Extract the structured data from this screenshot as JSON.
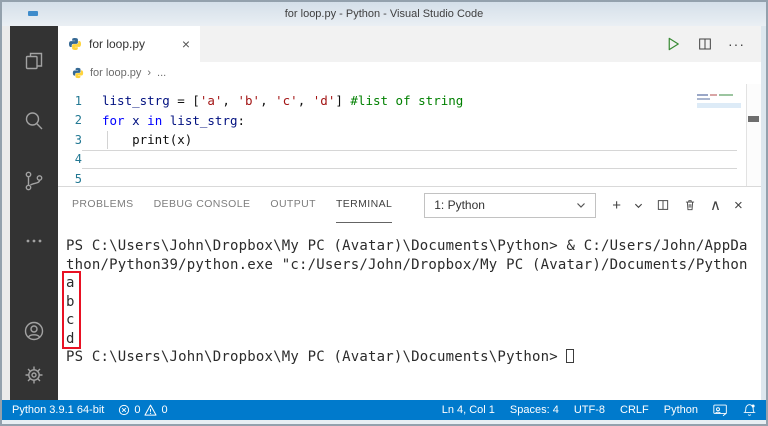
{
  "window": {
    "title": "for loop.py - Python - Visual Studio Code"
  },
  "activity_bar": {
    "items": [
      {
        "name": "explorer",
        "icon": "files-icon"
      },
      {
        "name": "search",
        "icon": "search-icon"
      },
      {
        "name": "source-control",
        "icon": "source-control-icon"
      },
      {
        "name": "more-views",
        "icon": "more-icon"
      }
    ],
    "bottom_items": [
      {
        "name": "account",
        "icon": "account-icon"
      },
      {
        "name": "settings",
        "icon": "gear-icon"
      }
    ]
  },
  "editor": {
    "tab": {
      "label": "for loop.py",
      "close": "×"
    },
    "actions": {
      "run_tooltip": "Run Python File",
      "more": "···"
    },
    "breadcrumb": {
      "file": "for loop.py",
      "sep": "›",
      "more": "..."
    },
    "code_lines": [
      {
        "num": "1",
        "tokens": [
          {
            "t": "list_strg",
            "c": "tok-var"
          },
          {
            "t": " = [",
            "c": "tok-p"
          },
          {
            "t": "'a'",
            "c": "tok-str"
          },
          {
            "t": ", ",
            "c": "tok-p"
          },
          {
            "t": "'b'",
            "c": "tok-str"
          },
          {
            "t": ", ",
            "c": "tok-p"
          },
          {
            "t": "'c'",
            "c": "tok-str"
          },
          {
            "t": ", ",
            "c": "tok-p"
          },
          {
            "t": "'d'",
            "c": "tok-str"
          },
          {
            "t": "] ",
            "c": "tok-p"
          },
          {
            "t": "#list of string",
            "c": "tok-com"
          }
        ]
      },
      {
        "num": "2",
        "tokens": [
          {
            "t": "for",
            "c": "tok-kw"
          },
          {
            "t": " ",
            "c": "tok-p"
          },
          {
            "t": "x",
            "c": "tok-var"
          },
          {
            "t": " ",
            "c": "tok-p"
          },
          {
            "t": "in",
            "c": "tok-kw"
          },
          {
            "t": " ",
            "c": "tok-p"
          },
          {
            "t": "list_strg",
            "c": "tok-var"
          },
          {
            "t": ":",
            "c": "tok-p"
          }
        ]
      },
      {
        "num": "3",
        "indent_guide": true,
        "tokens": [
          {
            "t": "    print(x)",
            "c": "tok-p"
          }
        ]
      },
      {
        "num": "4",
        "current": true,
        "tokens": []
      },
      {
        "num": "5",
        "tokens": []
      }
    ]
  },
  "panel": {
    "tabs": [
      {
        "label": "PROBLEMS"
      },
      {
        "label": "DEBUG CONSOLE"
      },
      {
        "label": "OUTPUT"
      },
      {
        "label": "TERMINAL",
        "active": true
      }
    ],
    "terminal_select": {
      "value": "1: Python"
    },
    "icons": {
      "new": "+",
      "split": "split-icon",
      "kill": "trash-icon",
      "maximize": "∧",
      "close": "×"
    },
    "terminal": {
      "lines": [
        {
          "text": "PS C:\\Users\\John\\Dropbox\\My PC (Avatar)\\Documents\\Python> & C:/Users/John/AppDa"
        },
        {
          "text": "thon/Python39/python.exe \"c:/Users/John/Dropbox/My PC (Avatar)/Documents/Python"
        },
        {
          "text": "a",
          "boxed": true
        },
        {
          "text": "b",
          "boxed": true
        },
        {
          "text": "c",
          "boxed": true
        },
        {
          "text": "d",
          "boxed": true
        },
        {
          "text": "PS C:\\Users\\John\\Dropbox\\My PC (Avatar)\\Documents\\Python> ",
          "cursor": true
        }
      ]
    }
  },
  "status_bar": {
    "interpreter": "Python 3.9.1 64-bit",
    "errors": "0",
    "warnings": "0",
    "right_items": [
      "Ln 4, Col 1",
      "Spaces: 4",
      "UTF-8",
      "CRLF",
      "Python"
    ]
  },
  "colors": {
    "accent": "#007acc",
    "activity_bar": "#333333",
    "annotation_red": "#e81123",
    "keyword": "#0000ff",
    "string": "#a31515",
    "comment": "#008000",
    "variable": "#001080",
    "line_number": "#237893"
  }
}
